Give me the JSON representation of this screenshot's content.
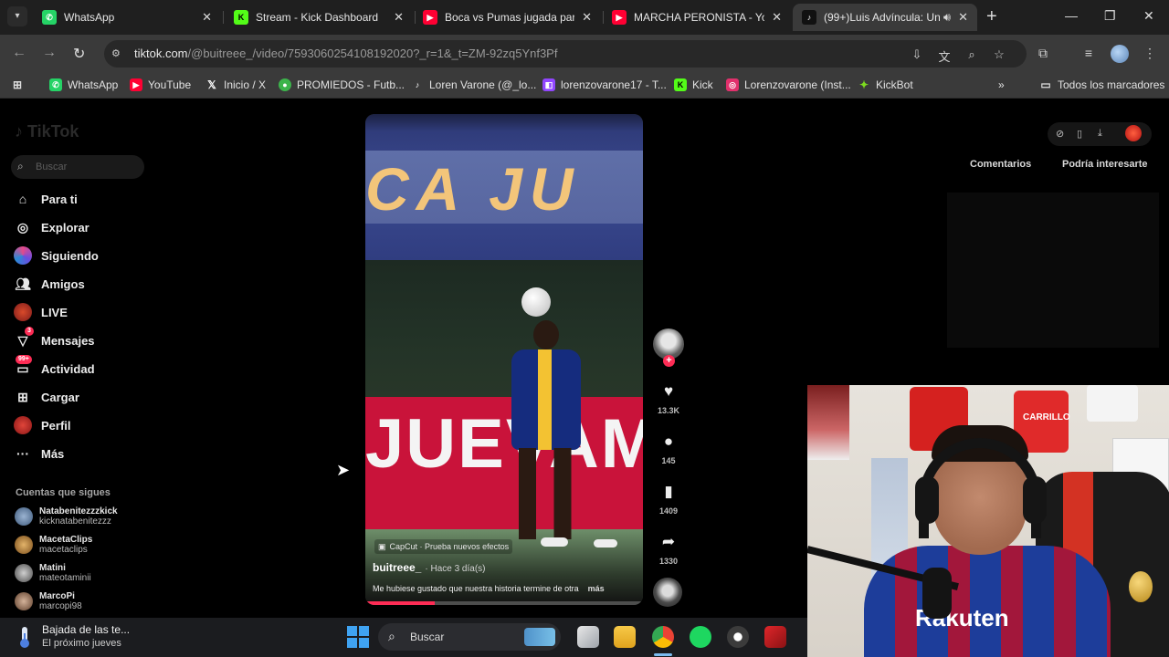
{
  "browser": {
    "tabs": [
      {
        "title": "WhatsApp",
        "icon": "whatsapp-icon",
        "color": "#25d366"
      },
      {
        "title": "Stream - Kick Dashboard",
        "icon": "kick-icon",
        "color": "#53fc18"
      },
      {
        "title": "Boca vs Pumas jugada para",
        "icon": "youtube-icon",
        "color": "#ff0033"
      },
      {
        "title": "MARCHA PERONISTA - YouT",
        "icon": "youtube-icon",
        "color": "#ff0033"
      },
      {
        "title": "(99+)Luis Advíncula: Un",
        "icon": "tiktok-icon",
        "color": "#ffffff"
      }
    ],
    "url_host": "tiktok.com",
    "url_path": "/@buitreee_/video/7593060254108192020?_r=1&_t=ZM-92zq5Ynf3Pf",
    "bookmarks": [
      {
        "label": "WhatsApp",
        "icon": "whatsapp-icon",
        "color": "#25d366"
      },
      {
        "label": "YouTube",
        "icon": "youtube-icon",
        "color": "#ff0033"
      },
      {
        "label": "Inicio / X",
        "icon": "x-icon",
        "color": "#ffffff"
      },
      {
        "label": "PROMIEDOS - Futb...",
        "icon": "promiedos-icon",
        "color": "#3cb44b"
      },
      {
        "label": "Loren Varone (@_lo...",
        "icon": "tiktok-icon",
        "color": "#ffffff"
      },
      {
        "label": "lorenzovarone17 - T...",
        "icon": "twitch-icon",
        "color": "#9146ff"
      },
      {
        "label": "Kick",
        "icon": "kick-icon",
        "color": "#53fc18"
      },
      {
        "label": "Lorenzovarone (Inst...",
        "icon": "instagram-icon",
        "color": "#e1306c"
      },
      {
        "label": "KickBot",
        "icon": "kickbot-icon",
        "color": "#7ddc1f"
      }
    ],
    "all_bookmarks": "Todos los marcadores"
  },
  "tiktok": {
    "logo": "TikTok",
    "search_placeholder": "Buscar",
    "menu": [
      {
        "label": "Para ti",
        "icon": "home-icon"
      },
      {
        "label": "Explorar",
        "icon": "compass-icon"
      },
      {
        "label": "Siguiendo",
        "icon": "following-icon"
      },
      {
        "label": "Amigos",
        "icon": "friends-icon"
      },
      {
        "label": "LIVE",
        "icon": "live-icon"
      },
      {
        "label": "Mensajes",
        "icon": "messages-icon",
        "badge": "3"
      },
      {
        "label": "Actividad",
        "icon": "activity-icon",
        "badge": "99+"
      },
      {
        "label": "Cargar",
        "icon": "upload-icon"
      },
      {
        "label": "Perfil",
        "icon": "profile-icon"
      },
      {
        "label": "Más",
        "icon": "more-icon"
      }
    ],
    "following_header": "Cuentas que sigues",
    "following": [
      {
        "name": "Natabenitezzzkick",
        "handle": "kicknatabenitezzz"
      },
      {
        "name": "MacetaClips",
        "handle": "macetaclips"
      },
      {
        "name": "Matini",
        "handle": "mateotaminii"
      },
      {
        "name": "MarcoPi",
        "handle": "marcopi98"
      }
    ],
    "video": {
      "banner_text": "CA JU",
      "board_text": "JUEVAM",
      "capcut": "CapCut · Prueba nuevos efectos",
      "author": "buitreee_",
      "posted": "· Hace 3 día(s)",
      "description": "Me hubiese gustado que nuestra historia termine de otra",
      "more": "más",
      "progress": 0.25
    },
    "actions": {
      "likes": "13.3K",
      "comments": "145",
      "saves": "1409",
      "shares": "1330"
    },
    "right_tabs": [
      "Comentarios",
      "Podría interesarte"
    ]
  },
  "webcam": {
    "jersey_name": "CARRILLO",
    "sponsor": "Rakuten"
  },
  "taskbar": {
    "weather_title": "Bajada de las te...",
    "weather_sub": "El próximo jueves",
    "search_placeholder": "Buscar"
  }
}
